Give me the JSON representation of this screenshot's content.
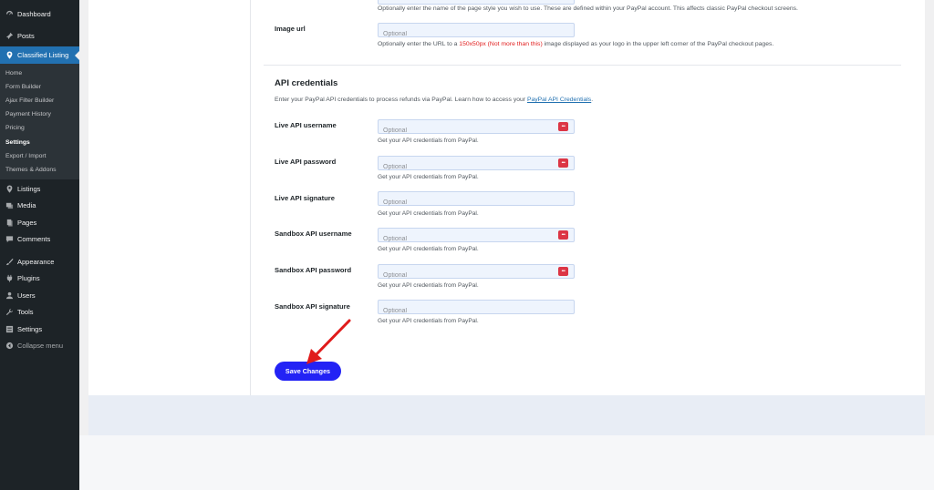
{
  "sidebar": {
    "items_top": [
      {
        "label": "Dashboard",
        "icon": "dashboard-icon"
      },
      {
        "label": "Posts",
        "icon": "pin-icon"
      },
      {
        "label": "Classified Listing",
        "icon": "listing-pin-icon"
      }
    ],
    "submenu": [
      {
        "label": "Home"
      },
      {
        "label": "Form Builder"
      },
      {
        "label": "Ajax Filter Builder"
      },
      {
        "label": "Payment History"
      },
      {
        "label": "Pricing"
      },
      {
        "label": "Settings"
      },
      {
        "label": "Export / Import"
      },
      {
        "label": "Themes & Addons"
      }
    ],
    "items_bottom": [
      {
        "label": "Listings",
        "icon": "listing-pin-icon"
      },
      {
        "label": "Media",
        "icon": "media-icon"
      },
      {
        "label": "Pages",
        "icon": "pages-icon"
      },
      {
        "label": "Comments",
        "icon": "comments-icon"
      },
      {
        "label": "Appearance",
        "icon": "brush-icon"
      },
      {
        "label": "Plugins",
        "icon": "plugin-icon"
      },
      {
        "label": "Users",
        "icon": "users-icon"
      },
      {
        "label": "Tools",
        "icon": "wrench-icon"
      },
      {
        "label": "Settings",
        "icon": "settings-icon"
      },
      {
        "label": "Collapse menu",
        "icon": "collapse-icon"
      }
    ]
  },
  "page_style": {
    "description": "Optionally enter the name of the page style you wish to use. These are defined within your PayPal account. This affects classic PayPal checkout screens."
  },
  "image_url": {
    "label": "Image url",
    "placeholder": "Optional",
    "desc_before": "Optionally enter the URL to a ",
    "desc_highlight": "150x50px (Not more than this)",
    "desc_after": " image displayed as your logo in the upper left corner of the PayPal checkout pages."
  },
  "api": {
    "title": "API credentials",
    "description": "Enter your PayPal API credentials to process refunds via PayPal. Learn how to access your ",
    "link": "PayPal API Credentials",
    "link_suffix": ".",
    "fields": [
      {
        "label": "Live API username",
        "placeholder": "Optional",
        "hint": "Get your API credentials from PayPal.",
        "has_key": true
      },
      {
        "label": "Live API password",
        "placeholder": "Optional",
        "hint": "Get your API credentials from PayPal.",
        "has_key": true
      },
      {
        "label": "Live API signature",
        "placeholder": "Optional",
        "hint": "Get your API credentials from PayPal.",
        "has_key": false
      },
      {
        "label": "Sandbox API username",
        "placeholder": "Optional",
        "hint": "Get your API credentials from PayPal.",
        "has_key": true
      },
      {
        "label": "Sandbox API password",
        "placeholder": "Optional",
        "hint": "Get your API credentials from PayPal.",
        "has_key": true
      },
      {
        "label": "Sandbox API signature",
        "placeholder": "Optional",
        "hint": "Get your API credentials from PayPal.",
        "has_key": false
      }
    ],
    "key_glyph": "•••"
  },
  "save_label": "Save Changes",
  "colors": {
    "sidebar_bg": "#1d2327",
    "active_menu": "#2271b1",
    "primary_button": "#2323f5",
    "key_button": "#dc3545",
    "annotation_arrow": "#e01b1b"
  }
}
